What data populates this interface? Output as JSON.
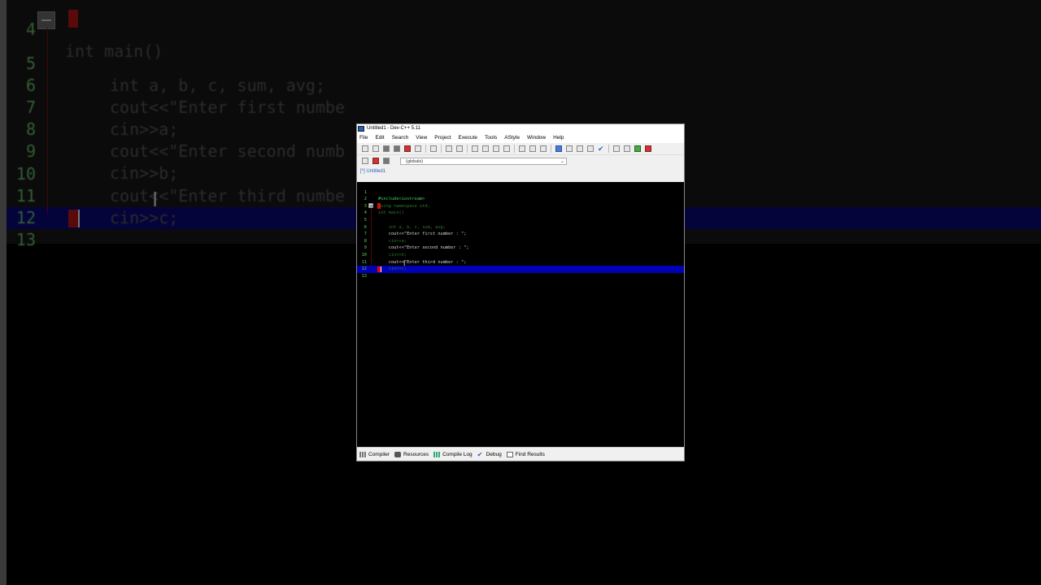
{
  "background_editor": {
    "lines": [
      {
        "num": "4",
        "text": "int main()"
      },
      {
        "num": "5",
        "text": "int a, b, c, sum, avg;"
      },
      {
        "num": "6",
        "text": "cout<<\"Enter first numbe"
      },
      {
        "num": "7",
        "text": "cin>>a;"
      },
      {
        "num": "8",
        "text": "cout<<\"Enter second numb"
      },
      {
        "num": "9",
        "text": "cin>>b;"
      },
      {
        "num": "10",
        "text": "cout<<\"Enter third numbe"
      },
      {
        "num": "11",
        "text": "cin>>c;"
      },
      {
        "num": "12",
        "text": ""
      },
      {
        "num": "13",
        "text": ""
      }
    ]
  },
  "window": {
    "title": "Untitled1 - Dev-C++ 5.11",
    "menu": [
      "File",
      "Edit",
      "Search",
      "View",
      "Project",
      "Execute",
      "Tools",
      "AStyle",
      "Window",
      "Help"
    ],
    "globals_select": "(globals)",
    "tab": "[*] Untitled1"
  },
  "editor": {
    "lines": [
      {
        "num": "1",
        "text": "#include<iostream>"
      },
      {
        "num": "2",
        "text": "using namespace std;"
      },
      {
        "num": "3",
        "text": "int main()"
      },
      {
        "num": "4",
        "text": ""
      },
      {
        "num": "5",
        "text": "    int a, b, c, sum, avg;"
      },
      {
        "num": "6",
        "text": "    cout<<\"Enter first number : \";"
      },
      {
        "num": "7",
        "text": "    cin>>a;"
      },
      {
        "num": "8",
        "text": "    cout<<\"Enter second number : \";"
      },
      {
        "num": "9",
        "text": "    cin>>b;"
      },
      {
        "num": "10",
        "text": "    cout<<\"Enter third number : \";"
      },
      {
        "num": "11",
        "text": "    cin>>c;"
      },
      {
        "num": "12",
        "text": ""
      },
      {
        "num": "13",
        "text": ""
      }
    ]
  },
  "bottom_tabs": [
    "Compiler",
    "Resources",
    "Compile Log",
    "Debug",
    "Find Results"
  ],
  "colors": {
    "current_line": "#0000b4",
    "breakpoint": "#e00000",
    "code_green": "#3fd35b"
  }
}
